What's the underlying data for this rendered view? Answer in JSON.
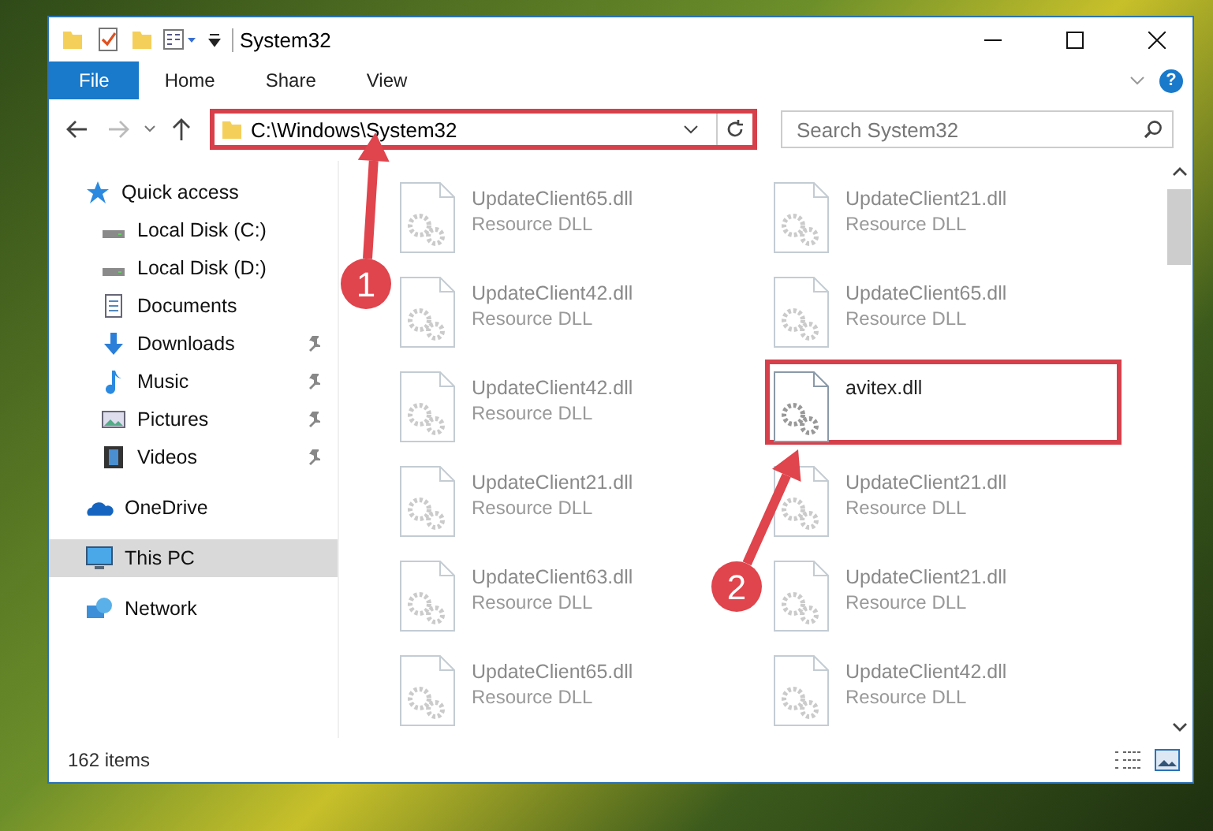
{
  "window": {
    "title": "System32"
  },
  "ribbon": {
    "tabs": [
      {
        "label": "File",
        "kind": "menu"
      },
      {
        "label": "Home",
        "kind": "tab"
      },
      {
        "label": "Share",
        "kind": "tab"
      },
      {
        "label": "View",
        "kind": "tab"
      }
    ],
    "help": "?"
  },
  "address_bar": {
    "path": "C:\\Windows\\System32",
    "highlighted": true
  },
  "search": {
    "placeholder": "Search System32"
  },
  "navigation": [
    {
      "label": "Quick access",
      "kind": "star",
      "selected": false,
      "children": [
        {
          "label": "Local Disk (C:)",
          "kind": "drive",
          "pinned": false,
          "selected": false
        },
        {
          "label": "Local Disk (D:)",
          "kind": "drive",
          "pinned": false,
          "selected": false
        },
        {
          "label": "Documents",
          "kind": "documents",
          "pinned": false,
          "selected": false
        },
        {
          "label": "Downloads",
          "kind": "downloads",
          "pinned": true,
          "selected": false
        },
        {
          "label": "Music",
          "kind": "music",
          "pinned": true,
          "selected": false
        },
        {
          "label": "Pictures",
          "kind": "pictures",
          "pinned": true,
          "selected": false
        },
        {
          "label": "Videos",
          "kind": "videos",
          "pinned": true,
          "selected": false
        }
      ]
    },
    {
      "label": "OneDrive",
      "kind": "cloud",
      "selected": false
    },
    {
      "label": "This PC",
      "kind": "pc",
      "selected": true
    },
    {
      "label": "Network",
      "kind": "network",
      "selected": false
    }
  ],
  "files": [
    {
      "name": "UpdateClient65.dll",
      "type": "Resource DLL",
      "dimmed": true,
      "highlighted": false
    },
    {
      "name": "UpdateClient21.dll",
      "type": "Resource DLL",
      "dimmed": true,
      "highlighted": false
    },
    {
      "name": "UpdateClient42.dll",
      "type": "Resource DLL",
      "dimmed": true,
      "highlighted": false
    },
    {
      "name": "UpdateClient65.dll",
      "type": "Resource DLL",
      "dimmed": true,
      "highlighted": false
    },
    {
      "name": "UpdateClient42.dll",
      "type": "Resource DLL",
      "dimmed": true,
      "highlighted": false
    },
    {
      "name": "avitex.dll",
      "dimmed": false,
      "highlighted": true
    },
    {
      "name": "UpdateClient21.dll",
      "type": "Resource DLL",
      "dimmed": true,
      "highlighted": false
    },
    {
      "name": "UpdateClient21.dll",
      "type": "Resource DLL",
      "dimmed": true,
      "highlighted": false
    },
    {
      "name": "UpdateClient63.dll",
      "type": "Resource DLL",
      "dimmed": true,
      "highlighted": false
    },
    {
      "name": "UpdateClient21.dll",
      "type": "Resource DLL",
      "dimmed": true,
      "highlighted": false
    },
    {
      "name": "UpdateClient65.dll",
      "type": "Resource DLL",
      "dimmed": true,
      "highlighted": false
    },
    {
      "name": "UpdateClient42.dll",
      "type": "Resource DLL",
      "dimmed": true,
      "highlighted": false
    }
  ],
  "annotations": [
    {
      "number": "1"
    },
    {
      "number": "2"
    }
  ],
  "status_bar": {
    "item_count": "162 items"
  }
}
